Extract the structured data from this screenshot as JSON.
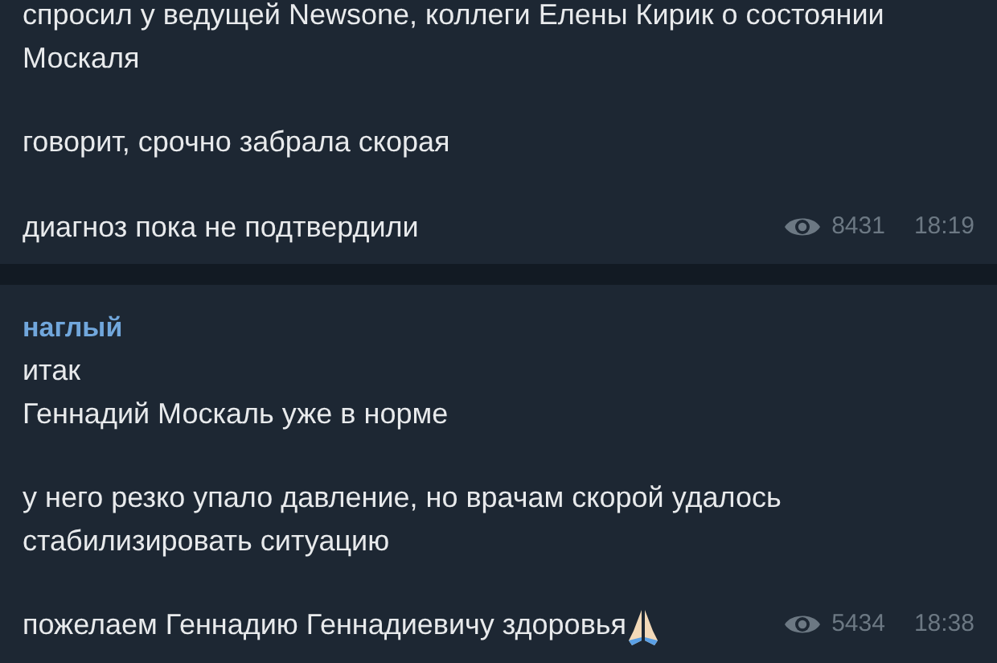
{
  "messages": [
    {
      "paragraphs": [
        "спросил у ведущей Newsone, коллеги Елены Кирик о состоянии Москаля",
        "говорит, срочно забрала скорая",
        "диагноз пока не подтвердили"
      ],
      "ends_with_emoji": false,
      "views": "8431",
      "time": "18:19"
    },
    {
      "author": "наглый",
      "paragraphs": [
        "итак\nГеннадий Москаль уже в норме",
        "у него резко упало давление, но врачам скорой удалось стабилизировать ситуацию",
        "пожелаем Геннадию Геннадиевичу здоровья"
      ],
      "ends_with_emoji": true,
      "views": "5434",
      "time": "18:38"
    }
  ]
}
